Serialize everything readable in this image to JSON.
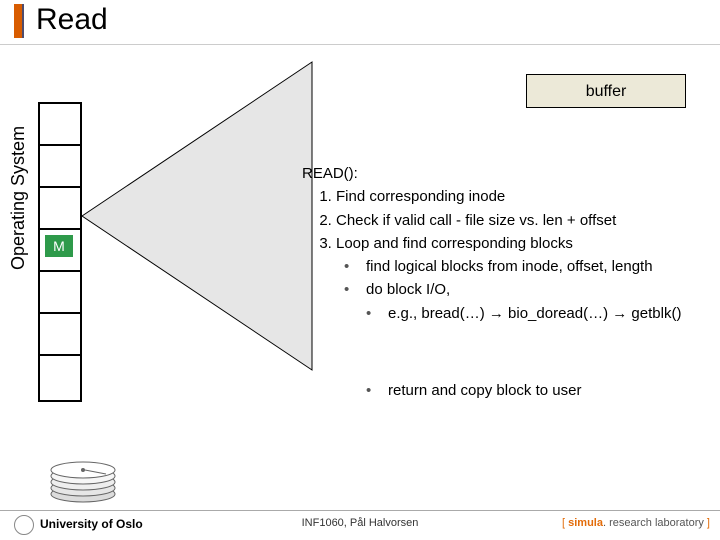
{
  "title": "Read",
  "buffer_label": "buffer",
  "os_label": "Operating System",
  "m_label": "M",
  "read": {
    "heading": "READ():",
    "steps": [
      "Find corresponding inode",
      "Check if valid call - file size vs. len + offset",
      "Loop and find corresponding blocks"
    ],
    "bullets": [
      "find logical blocks from inode, offset, length",
      "do block I/O,",
      "e.g., bread(…) → bio_doread(…) → getblk()"
    ],
    "return_line": "return and copy block to user"
  },
  "footer": {
    "left": "University of Oslo",
    "mid": "INF1060, Pål Halvorsen",
    "right_brand": "simula",
    "right_rest": ". research laboratory"
  }
}
